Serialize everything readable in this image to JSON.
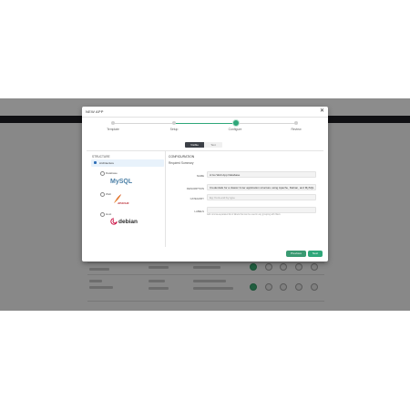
{
  "modal": {
    "title": "NEW APP",
    "close_glyph": "✕"
  },
  "stepper": {
    "steps": [
      "Template",
      "Setup",
      "Configure",
      "Review"
    ],
    "active_index": 2
  },
  "view_toggle": {
    "options": [
      "Visible",
      "Text"
    ],
    "selected": "Visible"
  },
  "structure": {
    "label": "STRUCTURE",
    "root": "Architecture",
    "items": [
      {
        "label": "Database",
        "logo": "MySQL"
      },
      {
        "label": "Web",
        "logo": "APACHE"
      },
      {
        "label": "Host",
        "logo": "debian"
      }
    ]
  },
  "configuration": {
    "title": "CONFIGURATION",
    "subtitle": "Required Summary",
    "fields": [
      {
        "label": "NAME",
        "value": "A Go Web App Database",
        "placeholder": ""
      },
      {
        "label": "DESCRIPTION",
        "value": "Credentials for a classic 3-tier application structure using Apache, Debian, and MySQL",
        "placeholder": ""
      },
      {
        "label": "CATEGORY",
        "value": "",
        "placeholder": "Eg: front-end by type"
      },
      {
        "label": "LABELS",
        "value": "",
        "placeholder": ""
      }
    ],
    "hint": "Add comma-separated list of labels that can be used in any grouping with filters"
  },
  "buttons": {
    "previous": "Previous",
    "next": "Next"
  },
  "colors": {
    "accent": "#2fa77a",
    "overlay": "#000000",
    "selected_row": "#e8f2fb"
  },
  "icons": [
    "close-icon",
    "architecture-icon",
    "mysql-logo",
    "apache-logo",
    "debian-logo"
  ]
}
